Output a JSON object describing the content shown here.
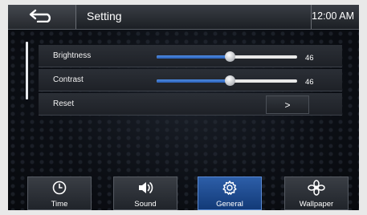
{
  "header": {
    "back_icon": "back-arrow-icon",
    "title": "Setting",
    "time": "12:00 AM"
  },
  "settings": {
    "rows": [
      {
        "label": "Brightness",
        "value": "46",
        "level_percent": 52
      },
      {
        "label": "Contrast",
        "value": "46",
        "level_percent": 52
      },
      {
        "label": "Reset",
        "action": ">"
      }
    ]
  },
  "tabs": [
    {
      "label": "Time",
      "icon": "clock-icon",
      "active": false
    },
    {
      "label": "Sound",
      "icon": "speaker-icon",
      "active": false
    },
    {
      "label": "General",
      "icon": "gear-icon",
      "active": true
    },
    {
      "label": "Wallpaper",
      "icon": "flower-icon",
      "active": false
    }
  ],
  "colors": {
    "accent": "#2d5ea8",
    "slider_fill": "#3f7ad6"
  }
}
